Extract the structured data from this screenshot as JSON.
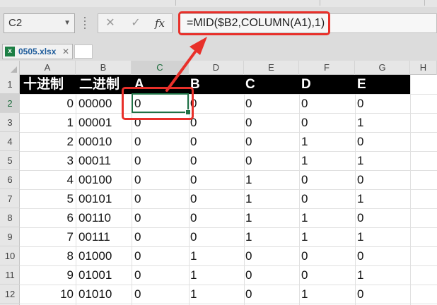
{
  "namebox": {
    "value": "C2"
  },
  "formula_toolbar": {
    "cancel_icon": "✕",
    "confirm_icon": "✓",
    "fx_label": "fx"
  },
  "formula_bar": {
    "value": "=MID($B2,COLUMN(A1),1)"
  },
  "workbook_tab": {
    "filename": "0505.xlsx",
    "close_icon": "✕",
    "icon_label": "x"
  },
  "columns": [
    "A",
    "B",
    "C",
    "D",
    "E",
    "F",
    "G",
    "H"
  ],
  "row_numbers": [
    "1",
    "2",
    "3",
    "4",
    "5",
    "6",
    "7",
    "8",
    "9",
    "10",
    "11",
    "12"
  ],
  "sheet": {
    "headers": [
      "十进制",
      "二进制",
      "A",
      "B",
      "C",
      "D",
      "E"
    ],
    "rows": [
      [
        "0",
        "00000",
        "0",
        "0",
        "0",
        "0",
        "0"
      ],
      [
        "1",
        "00001",
        "0",
        "0",
        "0",
        "0",
        "1"
      ],
      [
        "2",
        "00010",
        "0",
        "0",
        "0",
        "1",
        "0"
      ],
      [
        "3",
        "00011",
        "0",
        "0",
        "0",
        "1",
        "1"
      ],
      [
        "4",
        "00100",
        "0",
        "0",
        "1",
        "0",
        "0"
      ],
      [
        "5",
        "00101",
        "0",
        "0",
        "1",
        "0",
        "1"
      ],
      [
        "6",
        "00110",
        "0",
        "0",
        "1",
        "1",
        "0"
      ],
      [
        "7",
        "00111",
        "0",
        "0",
        "1",
        "1",
        "1"
      ],
      [
        "8",
        "01000",
        "0",
        "1",
        "0",
        "0",
        "0"
      ],
      [
        "9",
        "01001",
        "0",
        "1",
        "0",
        "0",
        "1"
      ],
      [
        "10",
        "01010",
        "0",
        "1",
        "0",
        "1",
        "0"
      ]
    ]
  },
  "colors": {
    "highlight": "#e8302a",
    "selection": "#1e7145",
    "header_band": "#000000"
  }
}
